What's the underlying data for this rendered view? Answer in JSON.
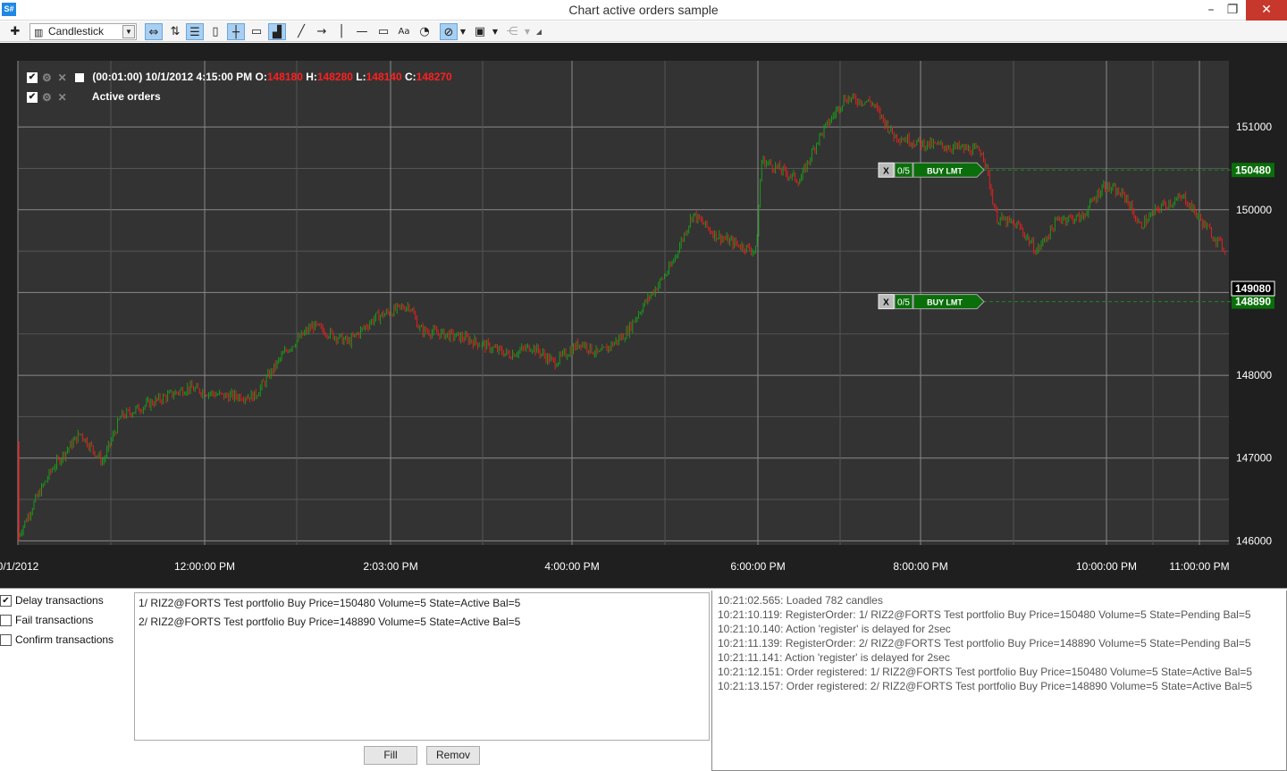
{
  "window": {
    "title": "Chart active orders sample",
    "app_icon": "S#"
  },
  "toolbar": {
    "chart_type": "Candlestick"
  },
  "chart": {
    "legend": {
      "series_header": "(00:01:00)  10/1/2012 4:15:00 PM O:",
      "o_value": "148180",
      "h_label": "H:",
      "h_value": "148280",
      "l_label": "L:",
      "l_value": "148140",
      "c_label": "C:",
      "c_value": "148270",
      "orders_label": "Active orders"
    },
    "price_ticks": [
      "151000",
      "150000",
      "149000",
      "148000",
      "147000",
      "146000"
    ],
    "time_ticks": [
      "0/1/2012",
      "12:00:00 PM",
      "2:03:00 PM",
      "4:00:00 PM",
      "6:00:00 PM",
      "8:00:00 PM",
      "10:00:00 PM",
      "11:00:00 PM"
    ],
    "current_price": "149080",
    "orders": [
      {
        "price": "150480",
        "price_value": 150480,
        "cancel": "X",
        "fill": "0/5",
        "label": "BUY LMT"
      },
      {
        "price": "148890",
        "price_value": 148890,
        "cancel": "X",
        "fill": "0/5",
        "label": "BUY LMT"
      }
    ],
    "up_color": "#1a9a1a",
    "down_color": "#e02020",
    "order_color": "#0a6e0a"
  },
  "options": [
    {
      "label": "Delay transactions",
      "checked": true
    },
    {
      "label": "Fail transactions",
      "checked": false
    },
    {
      "label": "Confirm transactions",
      "checked": false
    }
  ],
  "orders_list": [
    "1/ RIZ2@FORTS Test portfolio Buy Price=150480 Volume=5 State=Active Bal=5",
    "2/ RIZ2@FORTS Test portfolio Buy Price=148890 Volume=5 State=Active Bal=5"
  ],
  "buttons": {
    "fill": "Fill",
    "remove": "Remov"
  },
  "log": [
    "10:21:02.565: Loaded 782 candles",
    "10:21:10.119: RegisterOrder: 1/ RIZ2@FORTS Test portfolio Buy Price=150480 Volume=5 State=Pending Bal=5",
    "10:21:10.140: Action 'register' is delayed for 2sec",
    "10:21:11.139: RegisterOrder: 2/ RIZ2@FORTS Test portfolio Buy Price=148890 Volume=5 State=Pending Bal=5",
    "10:21:11.141: Action 'register' is delayed for 2sec",
    "10:21:12.151: Order registered: 1/ RIZ2@FORTS Test portfolio Buy Price=150480 Volume=5 State=Active Bal=5",
    "10:21:13.157: Order registered: 2/ RIZ2@FORTS Test portfolio Buy Price=148890 Volume=5 State=Active Bal=5"
  ]
}
